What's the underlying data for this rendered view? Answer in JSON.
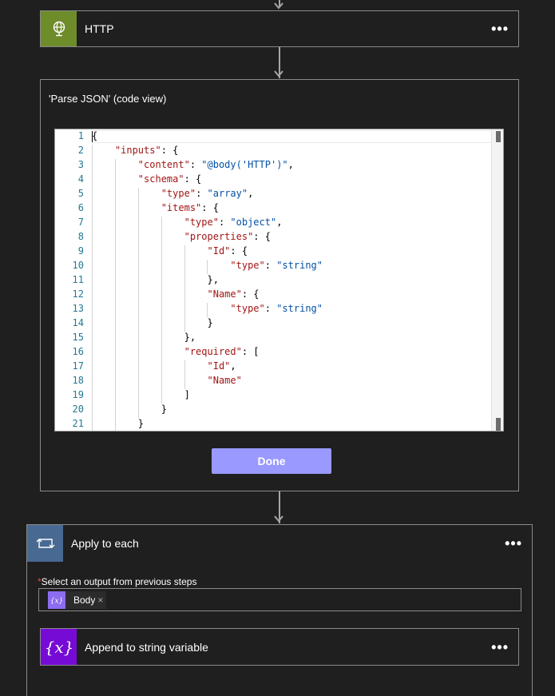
{
  "http_step": {
    "title": "HTTP",
    "more": "•••"
  },
  "parse_json": {
    "title": "'Parse JSON' (code view)",
    "done_label": "Done",
    "line_numbers": [
      "1",
      "2",
      "3",
      "4",
      "5",
      "6",
      "7",
      "8",
      "9",
      "10",
      "11",
      "12",
      "13",
      "14",
      "15",
      "16",
      "17",
      "18",
      "19",
      "20",
      "21"
    ],
    "code_lines": [
      {
        "pre": "{"
      },
      {
        "indent": "    ",
        "key": "\"inputs\"",
        "rest": ": {"
      },
      {
        "indent": "        ",
        "key": "\"content\"",
        "rest": ": ",
        "str": "\"@body('HTTP')\"",
        "post": ","
      },
      {
        "indent": "        ",
        "key": "\"schema\"",
        "rest": ": {"
      },
      {
        "indent": "            ",
        "key": "\"type\"",
        "rest": ": ",
        "str": "\"array\"",
        "post": ","
      },
      {
        "indent": "            ",
        "key": "\"items\"",
        "rest": ": {"
      },
      {
        "indent": "                ",
        "key": "\"type\"",
        "rest": ": ",
        "str": "\"object\"",
        "post": ","
      },
      {
        "indent": "                ",
        "key": "\"properties\"",
        "rest": ": {"
      },
      {
        "indent": "                    ",
        "key": "\"Id\"",
        "rest": ": {"
      },
      {
        "indent": "                        ",
        "key": "\"type\"",
        "rest": ": ",
        "str": "\"string\""
      },
      {
        "indent": "                    ",
        "pre": "},"
      },
      {
        "indent": "                    ",
        "key": "\"Name\"",
        "rest": ": {"
      },
      {
        "indent": "                        ",
        "key": "\"type\"",
        "rest": ": ",
        "str": "\"string\""
      },
      {
        "indent": "                    ",
        "pre": "}"
      },
      {
        "indent": "                ",
        "pre": "},"
      },
      {
        "indent": "                ",
        "key": "\"required\"",
        "rest": ": ["
      },
      {
        "indent": "                    ",
        "key": "\"Id\"",
        "post": ","
      },
      {
        "indent": "                    ",
        "key": "\"Name\""
      },
      {
        "indent": "                ",
        "pre": "]"
      },
      {
        "indent": "            ",
        "pre": "}"
      },
      {
        "indent": "        ",
        "pre": "}"
      }
    ]
  },
  "apply_each": {
    "title": "Apply to each",
    "more": "•••",
    "required_mark": "*",
    "select_label": "Select an output from previous steps",
    "token_label": "Body",
    "token_remove": "×"
  },
  "append_step": {
    "title": "Append to string variable",
    "more": "•••"
  },
  "colors": {
    "http_icon_bg": "#6e8c2a",
    "apply_icon_bg": "#486991",
    "var_icon_bg": "#770bd6",
    "token_icon_bg": "#8c6cf0",
    "done_bg": "#9999ff"
  }
}
